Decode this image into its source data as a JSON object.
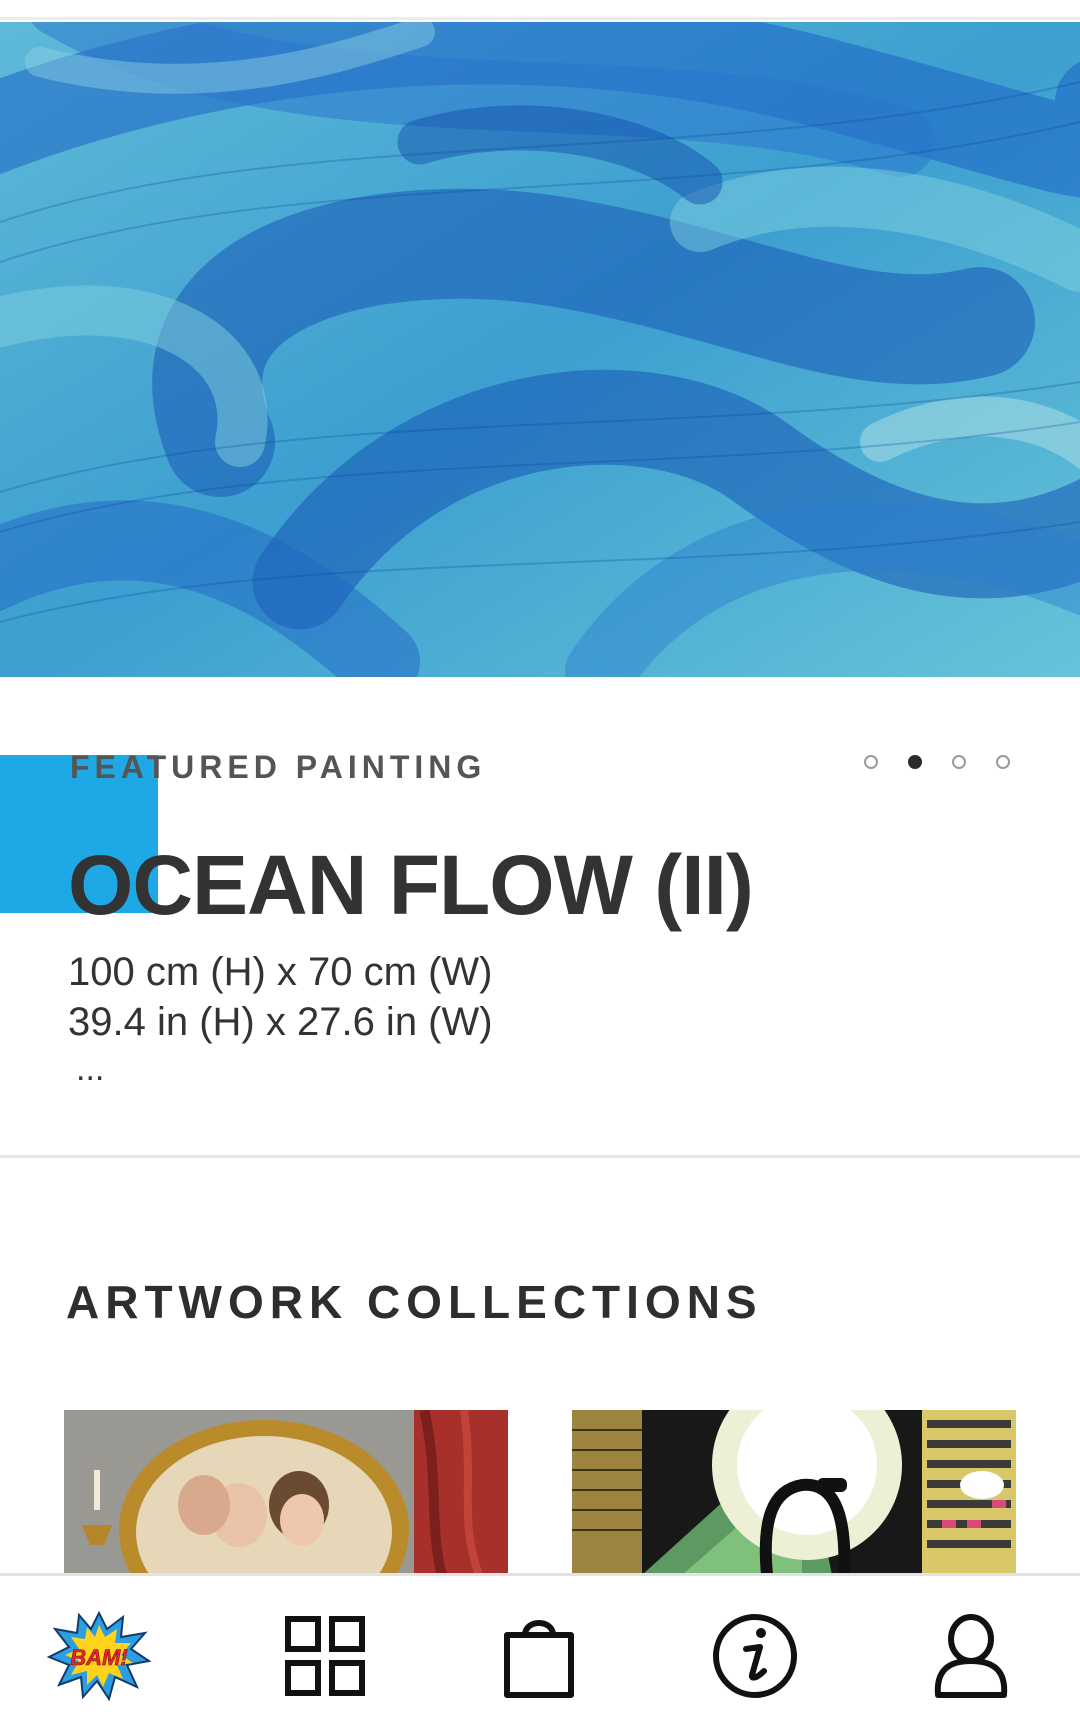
{
  "featured": {
    "label": "FEATURED PAINTING",
    "title": "OCEAN FLOW (II)",
    "dimensions_metric": "100 cm (H) x 70 cm (W)",
    "dimensions_imperial": "39.4 in (H) x 27.6 in (W)",
    "more": "...",
    "carousel": {
      "slide_count": 4,
      "active_index": 1
    }
  },
  "collections": {
    "title": "ARTWORK COLLECTIONS"
  },
  "bottom_nav": {
    "logo_text": "BAM!",
    "items": [
      "bam-logo",
      "grid-icon",
      "shopping-bag-icon",
      "info-icon",
      "user-icon"
    ]
  },
  "colors": {
    "accent": "#1ea8e6",
    "text_dark": "#333333",
    "text_label": "#555555",
    "divider": "#e6e6e6"
  }
}
